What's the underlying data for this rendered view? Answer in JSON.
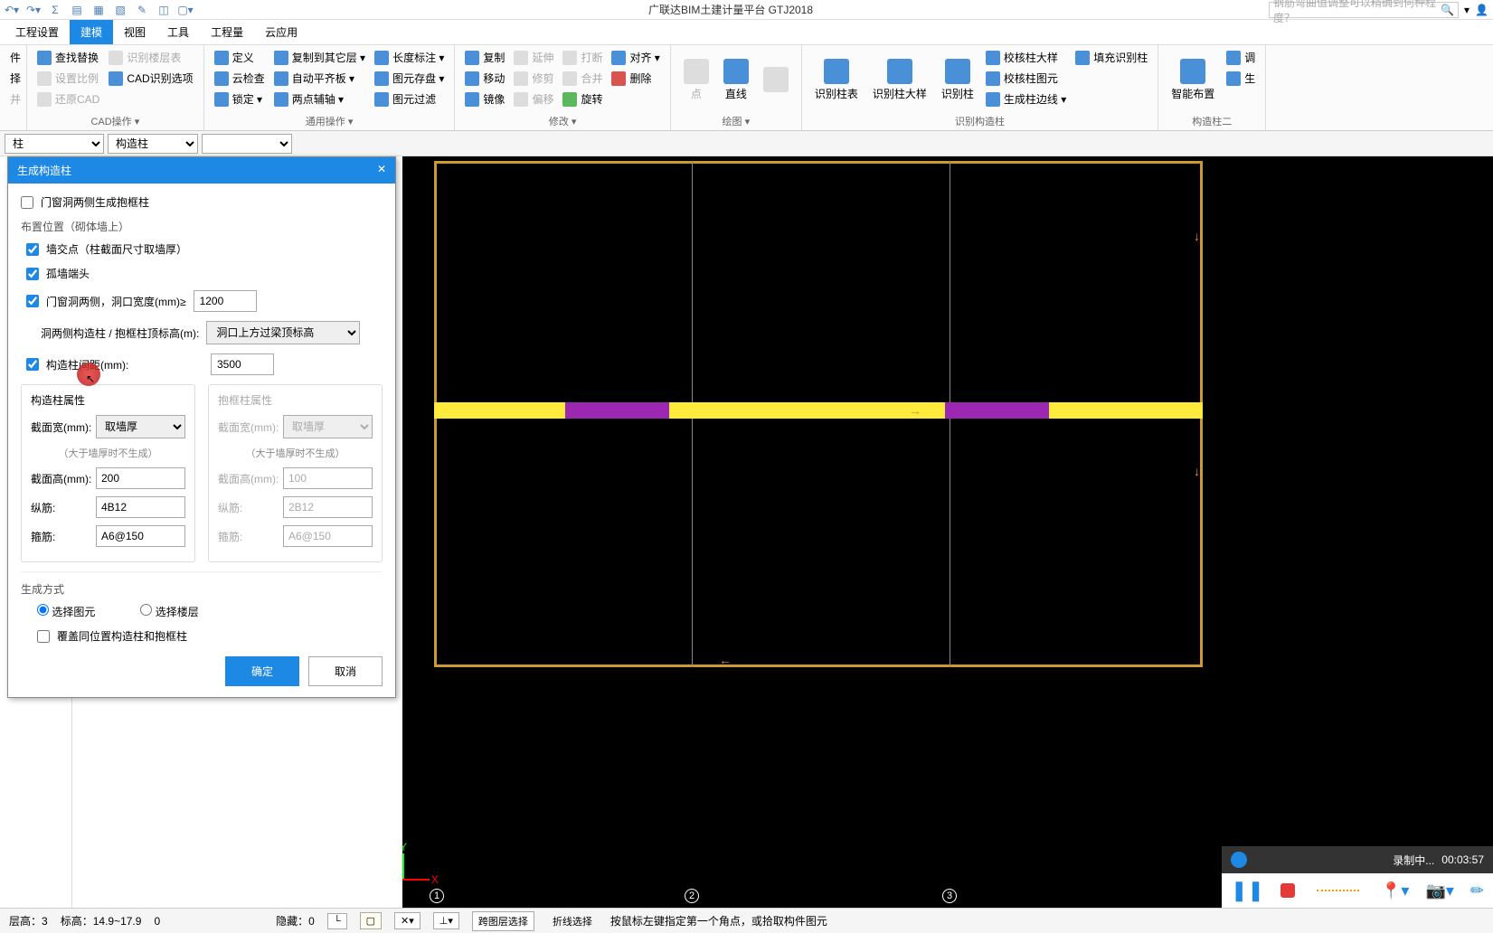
{
  "app_title": "广联达BIM土建计量平台 GTJ2018",
  "search_placeholder": "钢筋弯曲值调整可以精确到何种程度？",
  "menu": {
    "t1": "工程设置",
    "t2": "建模",
    "t3": "视图",
    "t4": "工具",
    "t5": "工程量",
    "t6": "云应用"
  },
  "ribbon": {
    "g1": {
      "a": "件",
      "b": "择",
      "c": "并"
    },
    "g2": {
      "a": "查找替换",
      "b": "设置比例",
      "c": "还原CAD",
      "d": "识别楼层表",
      "e": "CAD识别选项",
      "label": "CAD操作 ▾"
    },
    "g3": {
      "a": "定义",
      "b": "云检查",
      "c": "锁定 ▾",
      "d": "复制到其它层 ▾",
      "e": "自动平齐板 ▾",
      "f": "两点辅轴 ▾",
      "g": "长度标注 ▾",
      "h": "图元存盘 ▾",
      "i": "图元过滤",
      "label": "通用操作 ▾"
    },
    "g4": {
      "a": "复制",
      "b": "移动",
      "c": "镜像",
      "d": "延伸",
      "e": "修剪",
      "f": "偏移",
      "g": "打断",
      "h": "合并",
      "i": "旋转",
      "j": "对齐 ▾",
      "k": "删除",
      "label": "修改 ▾"
    },
    "g5": {
      "a": "点",
      "b": "直线",
      "label": "绘图 ▾"
    },
    "g6": {
      "a": "识别柱表",
      "b": "识别柱大样",
      "c": "识别柱",
      "d": "校核柱大样",
      "e": "校核柱图元",
      "f": "生成柱边线 ▾",
      "g": "填充识别柱",
      "label": "识别构造柱"
    },
    "g7": {
      "a": "智能布置",
      "b": "调",
      "c": "生",
      "label": "构造柱二"
    }
  },
  "selectors": {
    "s1": "柱",
    "s2": "构造柱",
    "s3": ""
  },
  "dialog": {
    "title": "生成构造柱",
    "chk_window": "门窗洞两侧生成抱框柱",
    "pos_label": "布置位置（砌体墙上）",
    "chk_wall": "墙交点（柱截面尺寸取墙厚）",
    "chk_orphan": "孤墙端头",
    "chk_opening": "门窗洞两侧，洞口宽度(mm)≥",
    "opening_val": "1200",
    "col_top_label": "洞两侧构造柱 / 抱框柱顶标高(m):",
    "col_top_sel": "洞口上方过梁顶标高",
    "chk_spacing": "构造柱间距(mm):",
    "spacing_val": "3500",
    "prop1": {
      "title": "构造柱属性",
      "w_label": "截面宽(mm):",
      "w_val": "取墙厚",
      "hint": "（大于墙厚时不生成）",
      "h_label": "截面高(mm):",
      "h_val": "200",
      "v_label": "纵筋:",
      "v_val": "4B12",
      "s_label": "箍筋:",
      "s_val": "A6@150"
    },
    "prop2": {
      "title": "抱框柱属性",
      "w_label": "截面宽(mm):",
      "w_val": "取墙厚",
      "hint": "（大于墙厚时不生成）",
      "h_label": "截面高(mm):",
      "h_val": "100",
      "v_label": "纵筋:",
      "v_val": "2B12",
      "s_label": "箍筋:",
      "s_val": "A6@150"
    },
    "gen_label": "生成方式",
    "radio1": "选择图元",
    "radio2": "选择楼层",
    "chk_override": "覆盖同位置构造柱和抱框柱",
    "ok": "确定",
    "cancel": "取消"
  },
  "status": {
    "floor_label": "层高：",
    "floor_val": "3",
    "elev_label": "标高：",
    "elev_val": "14.9~17.9",
    "zero": "0",
    "hide_label": "隐藏：",
    "hide_val": "0",
    "b1": "跨图层选择",
    "b2": "折线选择",
    "tip": "按鼠标左键指定第一个角点，或拾取构件图元"
  },
  "recorder": {
    "status": "录制中...",
    "time": "00:03:57"
  },
  "axes": {
    "x": "X",
    "y": "Y"
  },
  "grid": {
    "n1": "1",
    "n2": "2",
    "n3": "3"
  }
}
